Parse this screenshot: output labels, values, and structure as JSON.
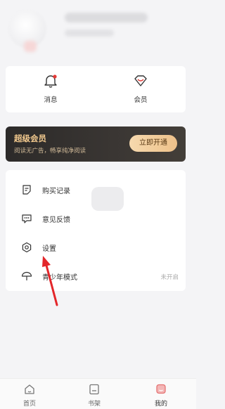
{
  "quick": [
    {
      "label": "消息",
      "icon": "bell-icon"
    },
    {
      "label": "会员",
      "icon": "gem-icon"
    }
  ],
  "vip": {
    "title": "超级会员",
    "subtitle": "阅读无广告，畅享纯净阅读",
    "button": "立即开通"
  },
  "list": [
    {
      "label": "购买记录",
      "icon": "purchase-record-icon",
      "value": ""
    },
    {
      "label": "意见反馈",
      "icon": "feedback-icon",
      "value": ""
    },
    {
      "label": "设置",
      "icon": "settings-icon",
      "value": ""
    },
    {
      "label": "青少年模式",
      "icon": "teen-mode-icon",
      "value": "未开启"
    }
  ],
  "tabs": [
    {
      "label": "首页",
      "icon": "home-icon"
    },
    {
      "label": "书架",
      "icon": "bookshelf-icon"
    },
    {
      "label": "我的",
      "icon": "profile-icon"
    }
  ],
  "colors": {
    "accent": "#e53935",
    "vip_gold": "#f2c98e",
    "arrow": "#e3262a"
  }
}
